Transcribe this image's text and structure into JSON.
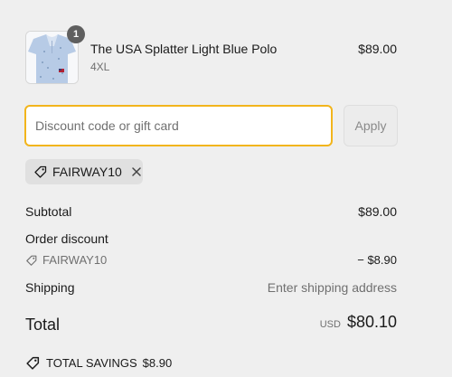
{
  "colors": {
    "accent": "#f2b51c",
    "background": "#efefef",
    "muted": "#707070"
  },
  "line_item": {
    "name": "The USA Splatter Light Blue Polo",
    "variant": "4XL",
    "price": "$89.00",
    "quantity": "1",
    "image_icon": "polo-shirt-thumbnail"
  },
  "discount_form": {
    "placeholder": "Discount code or gift card",
    "value": "",
    "apply_label": "Apply"
  },
  "applied_code": {
    "code": "FAIRWAY10",
    "tag_icon": "tag-icon",
    "remove_icon": "close-icon"
  },
  "summary": {
    "subtotal_label": "Subtotal",
    "subtotal_value": "$89.00",
    "order_discount_label": "Order discount",
    "discount_code": "FAIRWAY10",
    "discount_value": "− $8.90",
    "shipping_label": "Shipping",
    "shipping_value": "Enter shipping address",
    "total_label": "Total",
    "currency": "USD",
    "total_value": "$80.10",
    "savings_label": "TOTAL SAVINGS",
    "savings_value": "$8.90"
  }
}
